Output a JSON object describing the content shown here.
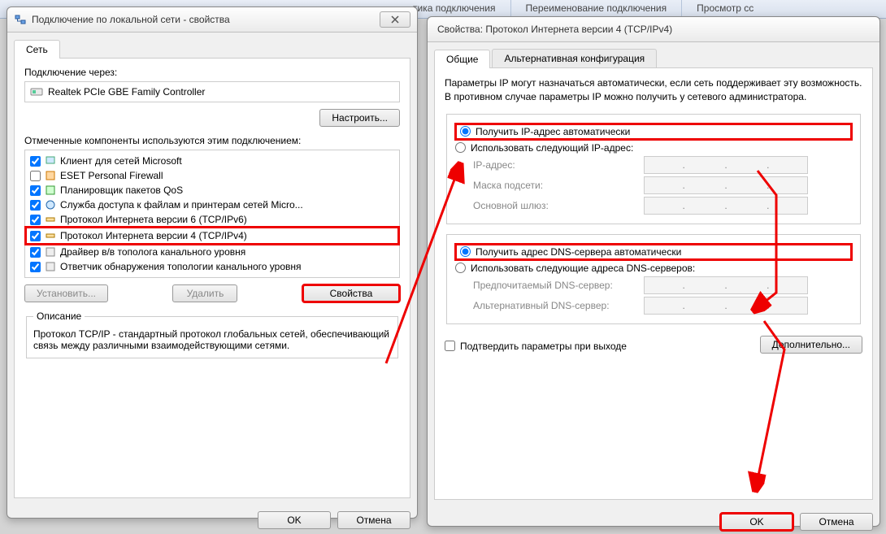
{
  "ribbon": {
    "items": [
      "тика подключения",
      "Переименование подключения",
      "Просмотр сс"
    ]
  },
  "left": {
    "title": "Подключение по локальной сети - свойства",
    "tab": "Сеть",
    "connect_via_label": "Подключение через:",
    "adapter_name": "Realtek PCIe GBE Family Controller",
    "configure_btn": "Настроить...",
    "components_label": "Отмеченные компоненты используются этим подключением:",
    "components": [
      {
        "checked": true,
        "label": "Клиент для сетей Microsoft",
        "hl": false
      },
      {
        "checked": false,
        "label": "ESET Personal Firewall",
        "hl": false
      },
      {
        "checked": true,
        "label": "Планировщик пакетов QoS",
        "hl": false
      },
      {
        "checked": true,
        "label": "Служба доступа к файлам и принтерам сетей Micro...",
        "hl": false
      },
      {
        "checked": true,
        "label": "Протокол Интернета версии 6 (TCP/IPv6)",
        "hl": false
      },
      {
        "checked": true,
        "label": "Протокол Интернета версии 4 (TCP/IPv4)",
        "hl": true
      },
      {
        "checked": true,
        "label": "Драйвер в/в тополога канального уровня",
        "hl": false
      },
      {
        "checked": true,
        "label": "Ответчик обнаружения топологии канального уровня",
        "hl": false
      }
    ],
    "install_btn": "Установить...",
    "remove_btn": "Удалить",
    "properties_btn": "Свойства",
    "description_group": "Описание",
    "description_text": "Протокол TCP/IP - стандартный протокол глобальных сетей, обеспечивающий связь между различными взаимодействующими сетями.",
    "ok_btn": "OK",
    "cancel_btn": "Отмена"
  },
  "right": {
    "title": "Свойства: Протокол Интернета версии 4 (TCP/IPv4)",
    "tabs": [
      "Общие",
      "Альтернативная конфигурация"
    ],
    "info": "Параметры IP могут назначаться автоматически, если сеть поддерживает эту возможность. В противном случае параметры IP можно получить у сетевого администратора.",
    "radio_ip_auto": "Получить IP-адрес автоматически",
    "radio_ip_manual": "Использовать следующий IP-адрес:",
    "ip_label": "IP-адрес:",
    "mask_label": "Маска подсети:",
    "gateway_label": "Основной шлюз:",
    "radio_dns_auto": "Получить адрес DNS-сервера автоматически",
    "radio_dns_manual": "Использовать следующие адреса DNS-серверов:",
    "dns1_label": "Предпочитаемый DNS-сервер:",
    "dns2_label": "Альтернативный DNS-сервер:",
    "confirm_on_exit": "Подтвердить параметры при выходе",
    "advanced_btn": "Дополнительно...",
    "ok_btn": "OK",
    "cancel_btn": "Отмена"
  }
}
